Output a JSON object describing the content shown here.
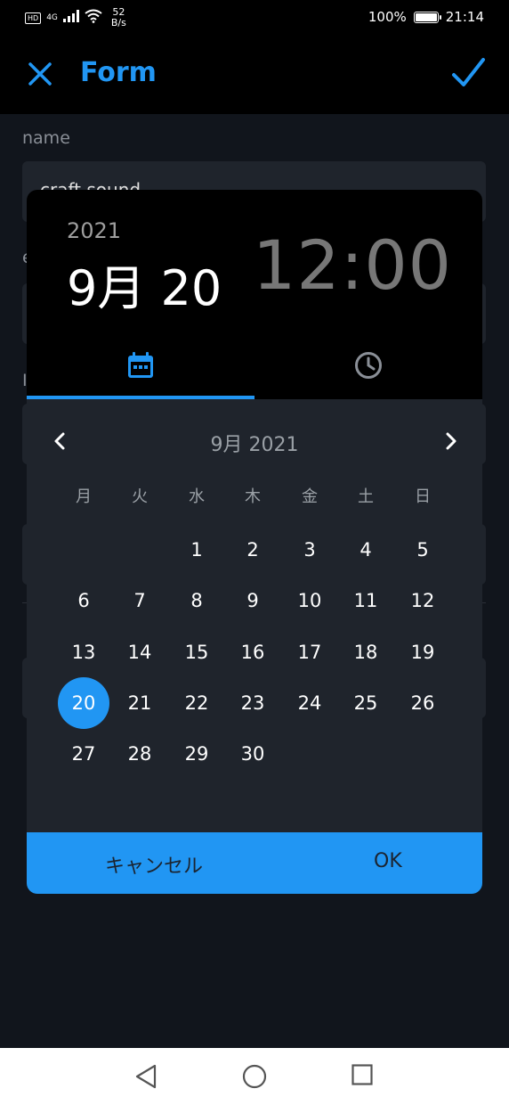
{
  "status_bar": {
    "hd": "HD",
    "network": "4G",
    "speed_value": "52",
    "speed_unit": "B/s",
    "battery": "100%",
    "time": "21:14"
  },
  "appbar": {
    "title": "Form",
    "close_icon": "close-icon",
    "confirm_icon": "check-icon"
  },
  "form": {
    "name_label": "name",
    "name_value": "craft sound",
    "label2_initial": "e",
    "label3_initial": "I"
  },
  "picker": {
    "year": "2021",
    "selected_date": "9月 20",
    "time": "12:00",
    "tabs": [
      {
        "icon": "calendar-icon",
        "active": true
      },
      {
        "icon": "clock-icon",
        "active": false
      }
    ],
    "month_label": "9月 2021",
    "weekdays": [
      "月",
      "火",
      "水",
      "木",
      "金",
      "土",
      "日"
    ],
    "days": [
      "1",
      "2",
      "3",
      "4",
      "5",
      "6",
      "7",
      "8",
      "9",
      "10",
      "11",
      "12",
      "13",
      "14",
      "15",
      "16",
      "17",
      "18",
      "19",
      "20",
      "21",
      "22",
      "23",
      "24",
      "25",
      "26",
      "27",
      "28",
      "29",
      "30"
    ],
    "selected_day": "20",
    "cancel_label": "キャンセル",
    "ok_label": "OK"
  },
  "colors": {
    "accent": "#2196f3",
    "background": "#11151c",
    "dialog": "#1f242c",
    "header": "#000000"
  }
}
